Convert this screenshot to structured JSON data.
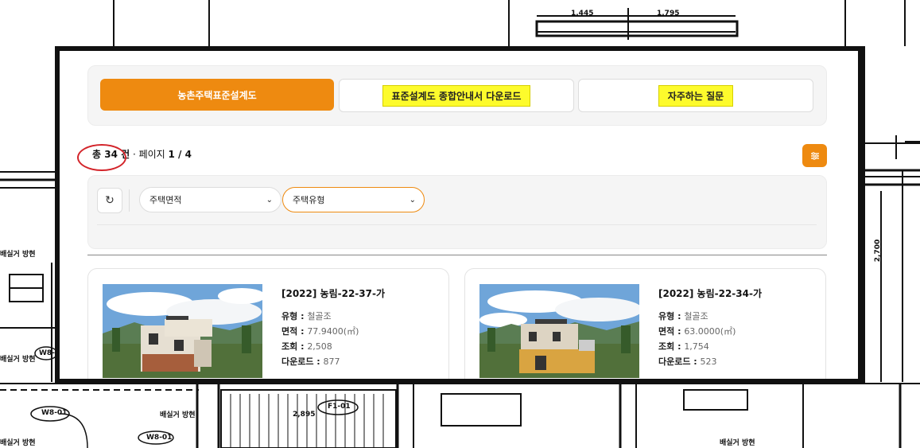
{
  "blueprint": {
    "dim_labels": [
      "1,445",
      "1,795",
      "2,700",
      "2,895"
    ],
    "tags": [
      "W8-01",
      "W8-01",
      "F1-01",
      "W8-01"
    ],
    "room_labels": [
      "배실거 방현",
      "배실거 방현",
      "배실거 방현",
      "배실거 방현",
      "배실거 방현"
    ]
  },
  "tabs": [
    {
      "label": "농촌주택표준설계도",
      "active": true
    },
    {
      "label": "표준설계도 종합안내서 다운로드",
      "active": false,
      "highlight": "#fdfb2c"
    },
    {
      "label": "자주하는 질문",
      "active": false,
      "highlight": "#fdfb2c"
    }
  ],
  "summary": {
    "prefix": "총 ",
    "total": "34",
    "unit": " 건",
    "separator": " · ",
    "page_label": "페이지 ",
    "page_value": "1 / 4"
  },
  "filter_button_icon": "sliders-icon",
  "filters": {
    "refresh_icon": "refresh-icon",
    "area": {
      "label": "주택면적"
    },
    "type": {
      "label": "주택유형"
    }
  },
  "listings": [
    {
      "title": "[2022] 농림-22-37-가",
      "type_label": "유형 : ",
      "type_value": "철골조",
      "area_label": "면적 : ",
      "area_value": "77.9400(㎡)",
      "views_label": "조회 : ",
      "views_value": "2,508",
      "downloads_label": "다운로드 : ",
      "downloads_value": "877"
    },
    {
      "title": "[2022] 농림-22-34-가",
      "type_label": "유형 : ",
      "type_value": "철골조",
      "area_label": "면적 : ",
      "area_value": "63.0000(㎡)",
      "views_label": "조회 : ",
      "views_value": "1,754",
      "downloads_label": "다운로드 : ",
      "downloads_value": "523"
    }
  ],
  "colors": {
    "accent": "#ee8a10",
    "highlight": "#fdfb2c",
    "annotation": "#d3242a"
  }
}
